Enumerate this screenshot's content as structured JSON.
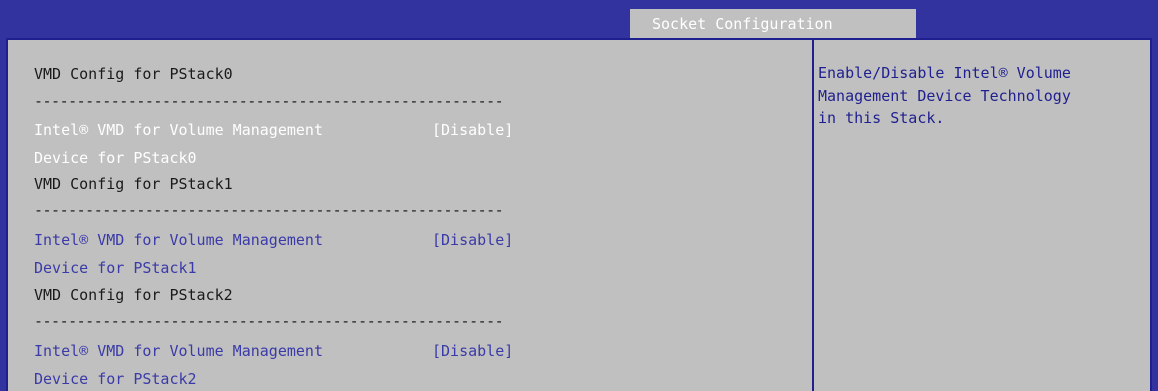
{
  "tabs": {
    "active": "Socket Configuration"
  },
  "groups": [
    {
      "heading": "VMD Config for PStack0",
      "separator": "-------------------------------------------------------",
      "option_line1": "Intel® VMD for Volume Management",
      "option_line2": "Device for PStack0",
      "value": "[Disable]"
    },
    {
      "heading": "VMD Config for PStack1",
      "separator": "-------------------------------------------------------",
      "option_line1": "Intel® VMD for Volume Management",
      "option_line2": "Device for PStack1",
      "value": "[Disable]"
    },
    {
      "heading": "VMD Config for PStack2",
      "separator": "-------------------------------------------------------",
      "option_line1": "Intel® VMD for Volume Management",
      "option_line2": "Device for PStack2",
      "value": "[Disable]"
    }
  ],
  "help": {
    "line1": "Enable/Disable Intel® Volume",
    "line2": "Management Device Technology",
    "line3": "in this Stack."
  },
  "colors": {
    "frame_blue": "#3333a0",
    "panel_gray": "#c0c0c0",
    "option_blue": "#3a3aa8",
    "selected_white": "#ffffff"
  }
}
